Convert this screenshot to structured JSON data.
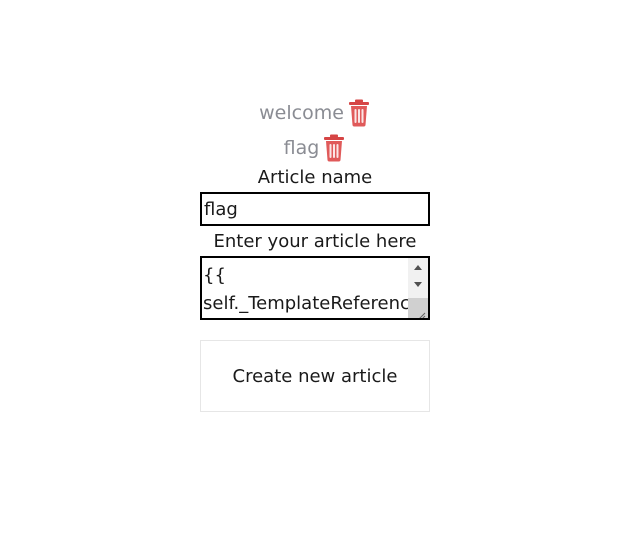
{
  "articles": [
    {
      "title": "welcome",
      "delete_icon": "trash-icon"
    },
    {
      "title": "flag",
      "delete_icon": "trash-icon"
    }
  ],
  "form": {
    "name_label": "Article name",
    "name_value": "flag",
    "body_label": "Enter your article here",
    "body_value": "{{\nself._TemplateReferenc",
    "submit_label": "Create new article"
  },
  "colors": {
    "link": "#8a8c93",
    "trash": "#e05a5a",
    "border": "#000000"
  }
}
